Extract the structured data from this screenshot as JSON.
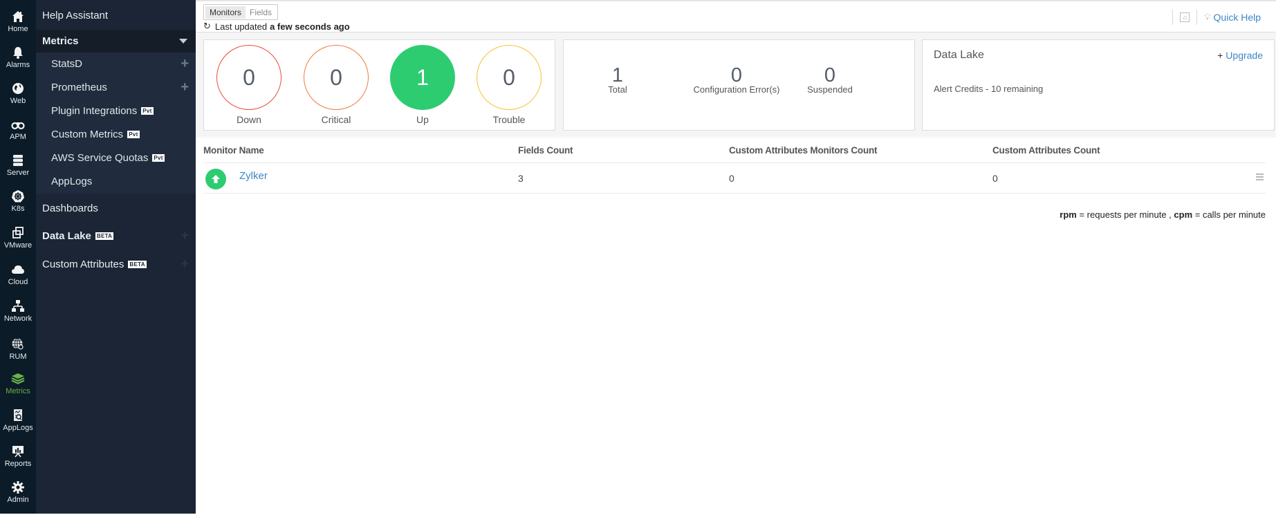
{
  "rail": {
    "items": [
      {
        "label": "Home",
        "icon": "home-icon"
      },
      {
        "label": "Alarms",
        "icon": "bell-icon"
      },
      {
        "label": "Web",
        "icon": "globe-icon"
      },
      {
        "label": "APM",
        "icon": "binoculars-icon"
      },
      {
        "label": "Server",
        "icon": "server-icon"
      },
      {
        "label": "K8s",
        "icon": "kubernetes-icon"
      },
      {
        "label": "VMware",
        "icon": "vmware-icon"
      },
      {
        "label": "Cloud",
        "icon": "cloud-icon"
      },
      {
        "label": "Network",
        "icon": "network-icon"
      },
      {
        "label": "RUM",
        "icon": "rum-icon"
      },
      {
        "label": "Metrics",
        "icon": "layers-icon",
        "active": true
      },
      {
        "label": "AppLogs",
        "icon": "applogs-icon"
      },
      {
        "label": "Reports",
        "icon": "reports-icon"
      },
      {
        "label": "Admin",
        "icon": "gear-icon"
      }
    ],
    "active_color": "#6ab04c"
  },
  "nav": {
    "help": "Help Assistant",
    "metrics": "Metrics",
    "sub": [
      {
        "label": "StatsD",
        "plus": true
      },
      {
        "label": "Prometheus",
        "plus": true
      },
      {
        "label": "Plugin Integrations",
        "badge": "Pvt"
      },
      {
        "label": "Custom Metrics",
        "badge": "Pvt"
      },
      {
        "label": "AWS Service Quotas",
        "badge": "Pvt"
      },
      {
        "label": "AppLogs"
      }
    ],
    "dashboards": "Dashboards",
    "data_lake": "Data Lake",
    "data_lake_badge": "BETA",
    "custom_attributes": "Custom Attributes",
    "custom_attributes_badge": "BETA",
    "plus": "+"
  },
  "header": {
    "tabs": [
      "Monitors",
      "Fields"
    ],
    "active_tab": "Monitors",
    "updated_prefix": "Last updated",
    "updated_value": "a few seconds ago",
    "quick_help": "Quick Help"
  },
  "status": {
    "rings": [
      {
        "label": "Down",
        "value": "0",
        "color": "#e74c3c"
      },
      {
        "label": "Critical",
        "value": "0",
        "color": "#f0793b"
      },
      {
        "label": "Up",
        "value": "1",
        "color": "#2ecc71"
      },
      {
        "label": "Trouble",
        "value": "0",
        "color": "#f4c430"
      }
    ],
    "stats": [
      {
        "label": "Total",
        "value": "1"
      },
      {
        "label": "Configuration Error(s)",
        "value": "0"
      },
      {
        "label": "Suspended",
        "value": "0"
      }
    ]
  },
  "data_lake": {
    "title": "Data Lake",
    "upgrade_plus": "+",
    "upgrade": "Upgrade",
    "credits": "Alert Credits - 10 remaining"
  },
  "table": {
    "columns": [
      "Monitor Name",
      "Fields Count",
      "Custom Attributes Monitors Count",
      "Custom Attributes Count"
    ],
    "rows": [
      {
        "name": "Zylker",
        "status": "up",
        "fields_count": "3",
        "ca_monitors_count": "0",
        "ca_count": "0"
      }
    ]
  },
  "legend": {
    "rpm": "rpm",
    "rpm_text": " = requests per minute , ",
    "cpm": "cpm",
    "cpm_text": " = calls per minute"
  }
}
